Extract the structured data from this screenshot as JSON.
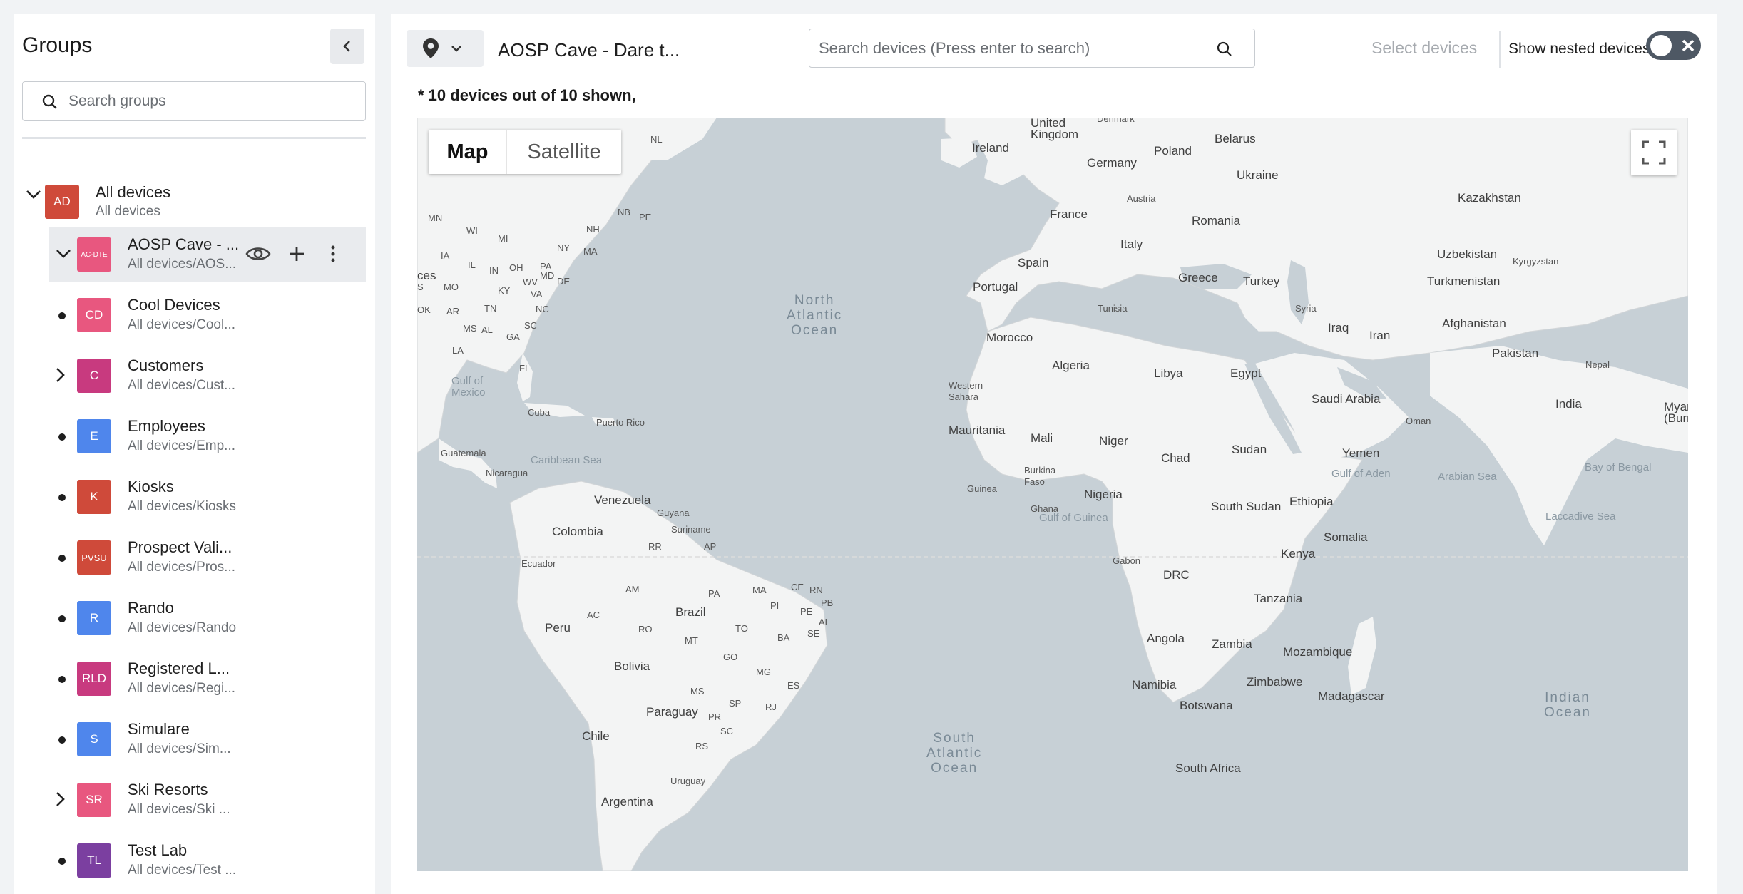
{
  "sidebar": {
    "title": "Groups",
    "search_placeholder": "Search groups",
    "root": {
      "avatar": "AD",
      "avatar_color": "#cf4a3a",
      "name": "All devices",
      "path": "All devices"
    },
    "items": [
      {
        "avatar": "AC-DTE",
        "avatar_color": "#e8577f",
        "name": "AOSP Cave - ...",
        "path": "All devices/AOS...",
        "expandable": true,
        "selected": true
      },
      {
        "avatar": "CD",
        "avatar_color": "#e8577f",
        "name": "Cool Devices",
        "path": "All devices/Cool..."
      },
      {
        "avatar": "C",
        "avatar_color": "#c83a7f",
        "name": "Customers",
        "path": "All devices/Cust...",
        "expandable": true
      },
      {
        "avatar": "E",
        "avatar_color": "#4f86ec",
        "name": "Employees",
        "path": "All devices/Emp..."
      },
      {
        "avatar": "K",
        "avatar_color": "#cf4a3a",
        "name": "Kiosks",
        "path": "All devices/Kiosks"
      },
      {
        "avatar": "PVSU",
        "avatar_color": "#cf4a3a",
        "name": "Prospect Vali...",
        "path": "All devices/Pros..."
      },
      {
        "avatar": "R",
        "avatar_color": "#4f86ec",
        "name": "Rando",
        "path": "All devices/Rando"
      },
      {
        "avatar": "RLD",
        "avatar_color": "#c83a7f",
        "name": "Registered L...",
        "path": "All devices/Regi..."
      },
      {
        "avatar": "S",
        "avatar_color": "#4f86ec",
        "name": "Simulare",
        "path": "All devices/Sim..."
      },
      {
        "avatar": "SR",
        "avatar_color": "#e8577f",
        "name": "Ski Resorts",
        "path": "All devices/Ski ...",
        "expandable": true
      },
      {
        "avatar": "TL",
        "avatar_color": "#7b3fa0",
        "name": "Test Lab",
        "path": "All devices/Test ..."
      }
    ]
  },
  "header": {
    "group_title": "AOSP Cave - Dare t...",
    "search_placeholder": "Search devices (Press enter to search)",
    "select_devices_label": "Select devices",
    "nested_label": "Show nested devices",
    "nested_enabled": false
  },
  "count_note": "* 10 devices out of 10 shown,",
  "map": {
    "type_options": [
      "Map",
      "Satellite"
    ],
    "selected_type": "Map",
    "labels": {
      "ireland": "Ireland",
      "uk": "United\nKingdom",
      "denmark": "Denmark",
      "poland": "Poland",
      "belarus": "Belarus",
      "germany": "Germany",
      "ukraine": "Ukraine",
      "austria": "Austria",
      "kazakhstan": "Kazakhstan",
      "france": "France",
      "romania": "Romania",
      "italy": "Italy",
      "uzbekistan": "Uzbekistan",
      "kyrgyzstan": "Kyrgyzstan",
      "spain": "Spain",
      "greece": "Greece",
      "turkey": "Turkey",
      "turkmenistan": "Turkmenistan",
      "portugal": "Portugal",
      "syria": "Syria",
      "tunisia": "Tunisia",
      "iraq": "Iraq",
      "afghanistan": "Afghanistan",
      "iran": "Iran",
      "morocco": "Morocco",
      "pakistan": "Pakistan",
      "algeria": "Algeria",
      "libya": "Libya",
      "egypt": "Egypt",
      "nepal": "Nepal",
      "western_sahara": "Western\nSahara",
      "saudi_arabia": "Saudi Arabia",
      "india": "India",
      "myanmar": "Myanm\n(Burm",
      "oman": "Oman",
      "mauritania": "Mauritania",
      "mali": "Mali",
      "niger": "Niger",
      "chad": "Chad",
      "sudan": "Sudan",
      "yemen": "Yemen",
      "burkina_faso": "Burkina\nFaso",
      "guinea": "Guinea",
      "nigeria": "Nigeria",
      "ghana": "Ghana",
      "ethiopia": "Ethiopia",
      "south_sudan": "South Sudan",
      "somalia": "Somalia",
      "kenya": "Kenya",
      "gabon": "Gabon",
      "drc": "DRC",
      "tanzania": "Tanzania",
      "angola": "Angola",
      "zambia": "Zambia",
      "mozambique": "Mozambique",
      "zimbabwe": "Zimbabwe",
      "namibia": "Namibia",
      "botswana": "Botswana",
      "madagascar": "Madagascar",
      "south_africa": "South Africa",
      "venezuela": "Venezuela",
      "guyana": "Guyana",
      "suriname": "Suriname",
      "colombia": "Colombia",
      "ecuador": "Ecuador",
      "peru": "Peru",
      "brazil": "Brazil",
      "bolivia": "Bolivia",
      "paraguay": "Paraguay",
      "chile": "Chile",
      "uruguay": "Uruguay",
      "argentina": "Argentina",
      "cuba": "Cuba",
      "puerto_rico": "Puerto Rico",
      "guatemala": "Guatemala",
      "nicaragua": "Nicaragua",
      "north_atlantic": "North\nAtlantic\nOcean",
      "south_atlantic": "South\nAtlantic\nOcean",
      "indian_ocean": "Indian\nOcean",
      "gulf_mexico": "Gulf of\nMexico",
      "caribbean": "Caribbean Sea",
      "gulf_guinea": "Gulf of Guinea",
      "gulf_aden": "Gulf of Aden",
      "arabian_sea": "Arabian Sea",
      "bay_bengal": "Bay of Bengal",
      "laccadive": "Laccadive Sea",
      "nl": "NL",
      "nb": "NB",
      "pe": "PE",
      "mn": "MN",
      "wi": "WI",
      "mi": "MI",
      "ny": "NY",
      "nh": "NH",
      "ma": "MA",
      "ia": "IA",
      "il": "IL",
      "in": "IN",
      "oh": "OH",
      "pa": "PA",
      "md": "MD",
      "de": "DE",
      "ces": "ces",
      "s": "S",
      "mo": "MO",
      "ky": "KY",
      "wv": "WV",
      "va": "VA",
      "ok": "OK",
      "ar": "AR",
      "tn": "TN",
      "nc": "NC",
      "ms": "MS",
      "al": "AL",
      "ga": "GA",
      "sc": "SC",
      "la": "LA",
      "fl": "FL",
      "rr": "RR",
      "ap": "AP",
      "am": "AM",
      "pa2": "PA",
      "ma2": "MA",
      "ce": "CE",
      "rn": "RN",
      "pb": "PB",
      "pi": "PI",
      "pe2": "PE",
      "al2": "AL",
      "ac": "AC",
      "ro": "RO",
      "to": "TO",
      "se": "SE",
      "mt": "MT",
      "ba": "BA",
      "go": "GO",
      "mg": "MG",
      "es": "ES",
      "ms2": "MS",
      "sp": "SP",
      "rj": "RJ",
      "pr": "PR",
      "sc2": "SC",
      "rs": "RS"
    }
  }
}
